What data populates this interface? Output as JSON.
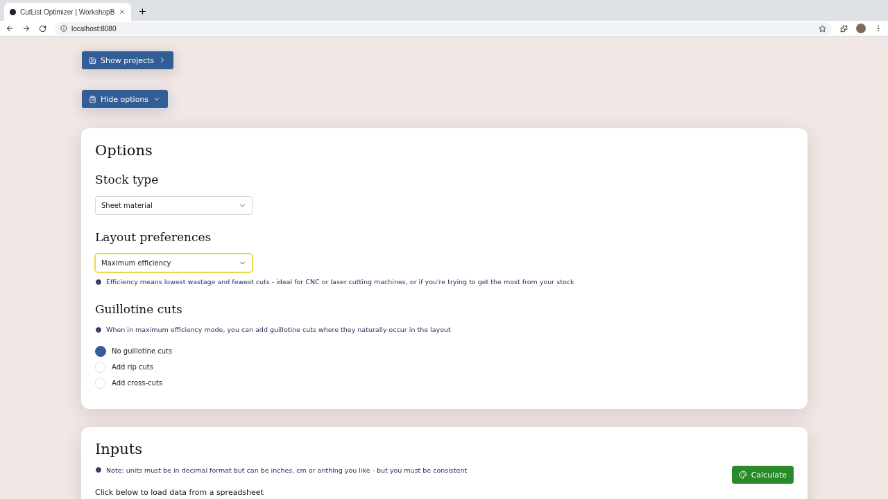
{
  "browser": {
    "tab_title": "CutList Optimizer | WorkshopB",
    "address": "localhost:8080"
  },
  "buttons": [
    {
      "label": "Show projects",
      "kind": "projects"
    },
    {
      "label": "Hide options",
      "kind": "options"
    }
  ],
  "options": {
    "title": "Options",
    "stock_type": {
      "heading": "Stock type",
      "value": "Sheet material",
      "focused": false
    },
    "layout": {
      "heading": "Layout preferences",
      "value": "Maximum efficiency",
      "focused": true,
      "info": "Efficiency means lowest wastage and fewest cuts - ideal for CNC or laser cutting machines, or if you're trying to get the most from your stock"
    },
    "guillotine": {
      "heading": "Guillotine cuts",
      "info": "When in maximum efficiency mode, you can add guillotine cuts where they naturally occur in the layout",
      "choices": [
        {
          "label": "No guillotine cuts",
          "selected": true
        },
        {
          "label": "Add rip cuts",
          "selected": false
        },
        {
          "label": "Add cross-cuts",
          "selected": false
        }
      ]
    }
  },
  "inputs": {
    "title": "Inputs",
    "note": "Note: units must be in decimal format but can be inches, cm or anthing you like - but you must be consistent",
    "calculate": "Calculate",
    "load_text": "Click below to load data from a spreadsheet"
  }
}
